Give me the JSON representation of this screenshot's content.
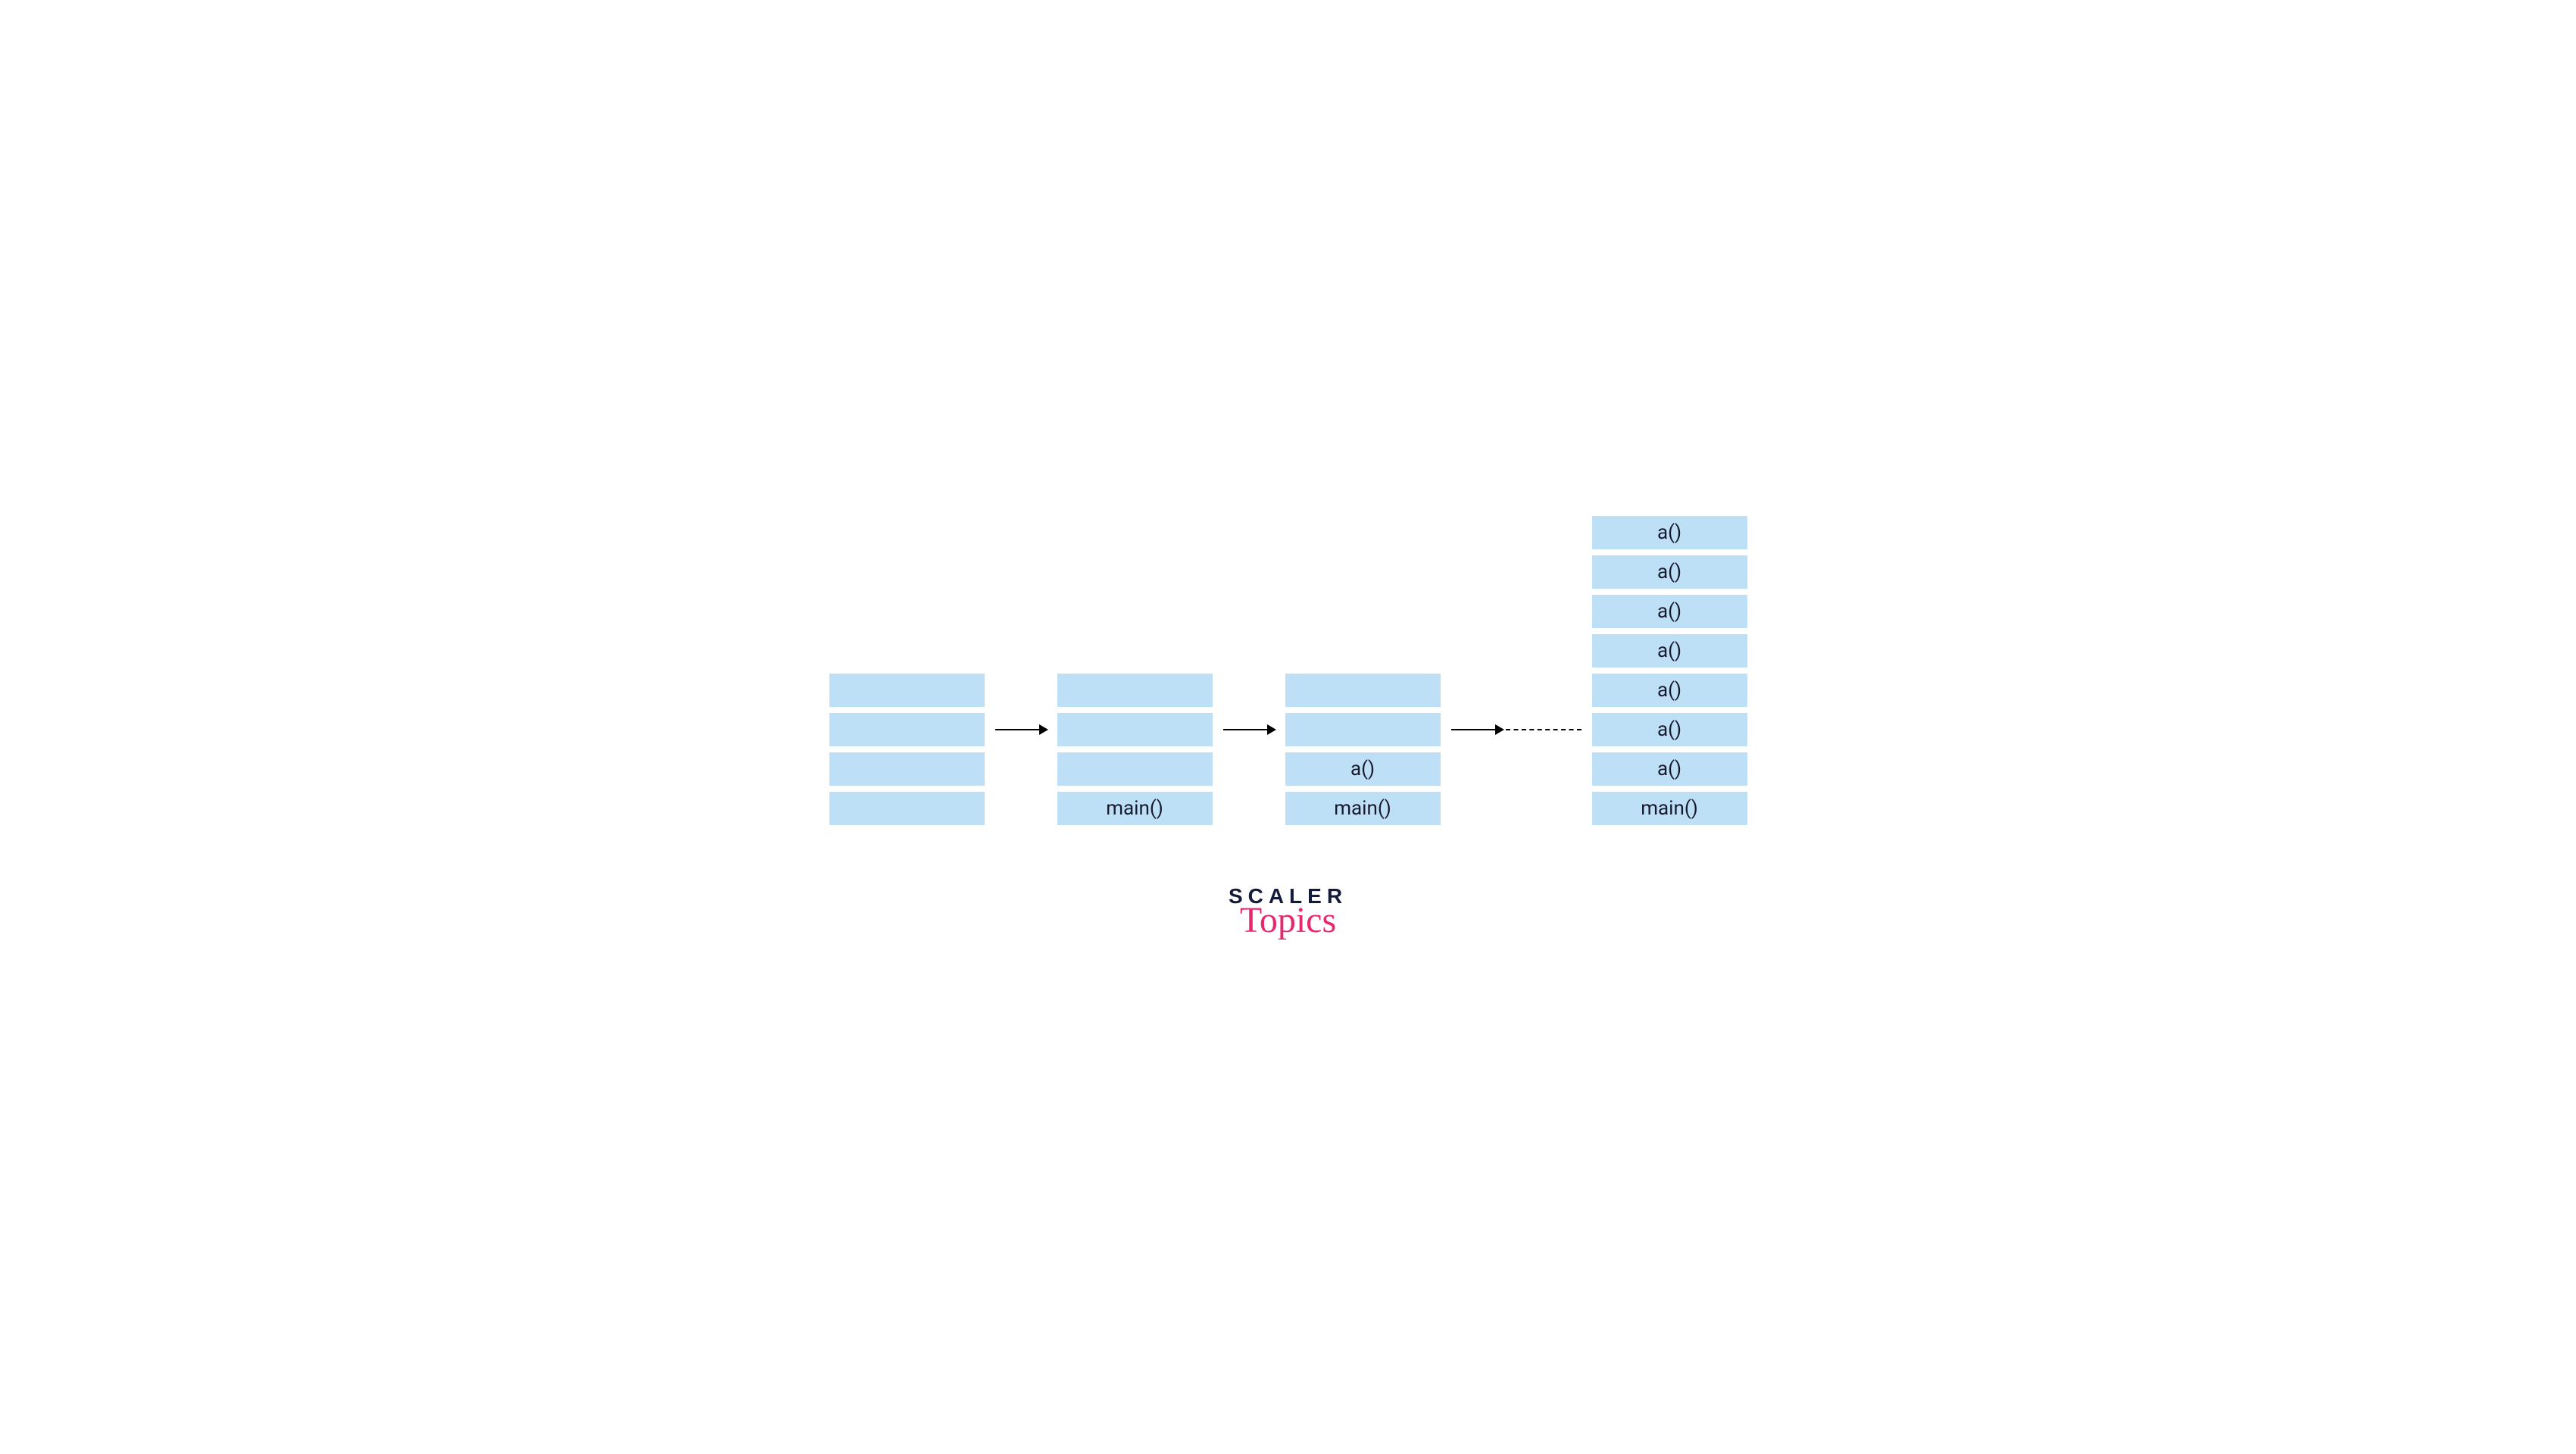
{
  "stacks": [
    {
      "frames": [
        "",
        "",
        "",
        ""
      ]
    },
    {
      "frames": [
        "",
        "",
        "",
        "main()"
      ]
    },
    {
      "frames": [
        "",
        "",
        "a()",
        "main()"
      ]
    },
    {
      "frames": [
        "a()",
        "a()",
        "a()",
        "a()",
        "a()",
        "a()",
        "a()",
        "main()"
      ]
    }
  ],
  "arrows": [
    {
      "dashed": false
    },
    {
      "dashed": false
    },
    {
      "dashed": true
    }
  ],
  "logo": {
    "line1": "SCALER",
    "line2": "Topics"
  }
}
